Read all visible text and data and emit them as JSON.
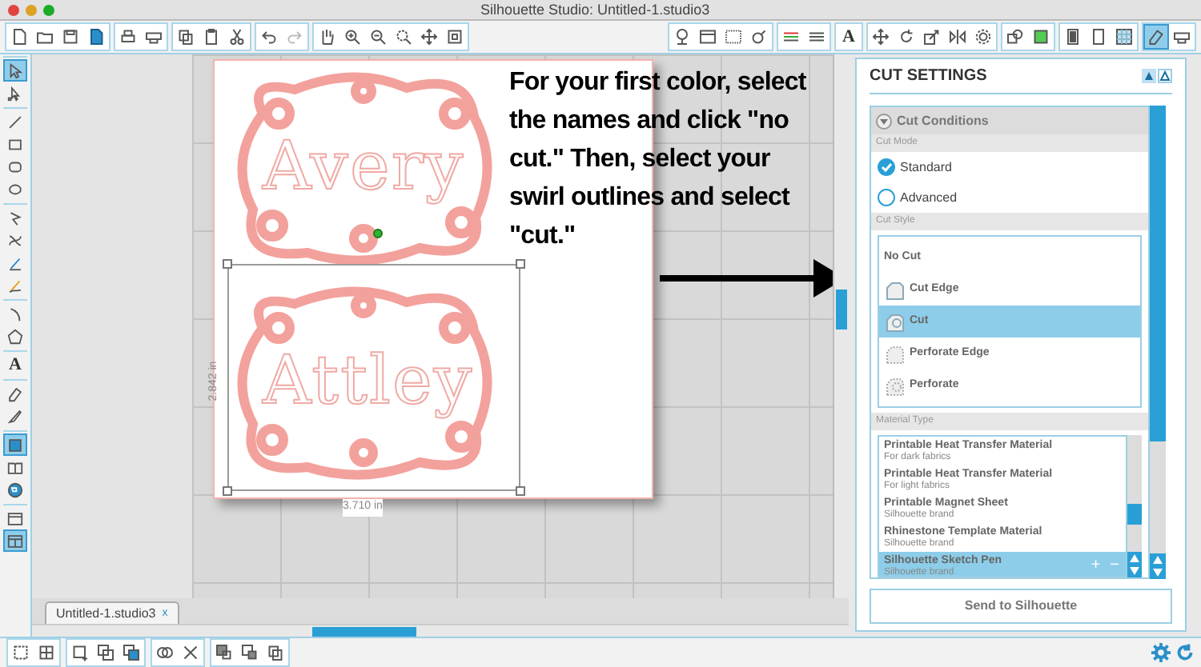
{
  "window": {
    "title": "Silhouette Studio: Untitled-1.studio3"
  },
  "top_toolbar": {
    "left_groups": [
      [
        {
          "kind": "page"
        },
        {
          "kind": "folder"
        },
        {
          "kind": "disk"
        },
        {
          "kind": "filled-page"
        }
      ],
      [
        {
          "kind": "printer"
        },
        {
          "kind": "cutter"
        }
      ],
      [
        {
          "kind": "two-pages"
        },
        {
          "kind": "clipboard"
        },
        {
          "kind": "scissors"
        }
      ],
      [
        {
          "kind": "undo-arrow"
        },
        {
          "kind": "redo-arrow"
        }
      ],
      [
        {
          "kind": "hand"
        },
        {
          "kind": "magnifier-plus"
        },
        {
          "kind": "magnifier-minus"
        },
        {
          "kind": "magnifier-box"
        },
        {
          "kind": "four-arrows"
        },
        {
          "kind": "corner-square"
        }
      ]
    ],
    "right_groups": [
      [
        {
          "kind": "pin-globe",
          "selected": false
        },
        {
          "kind": "window",
          "selected": false
        },
        {
          "kind": "dotted-grid",
          "selected": false
        },
        {
          "kind": "ring",
          "selected": false
        }
      ],
      [
        {
          "kind": "color-lines",
          "selected": false
        },
        {
          "kind": "lines",
          "selected": false
        }
      ],
      [
        {
          "kind": "glyph",
          "glyph": "A",
          "selected": false
        }
      ],
      [
        {
          "kind": "four-arrows",
          "selected": false
        },
        {
          "kind": "rotate",
          "selected": false
        },
        {
          "kind": "scale-box",
          "selected": false
        },
        {
          "kind": "mirror",
          "selected": false
        },
        {
          "kind": "gear",
          "selected": false
        }
      ],
      [
        {
          "kind": "stacked-shapes",
          "selected": false
        },
        {
          "kind": "filled-square",
          "selected": false
        }
      ],
      [
        {
          "kind": "tall-page",
          "selected": false
        },
        {
          "kind": "page-outline",
          "selected": false
        },
        {
          "kind": "grid-page",
          "selected": false
        }
      ],
      [
        {
          "kind": "eraser",
          "selected": true
        },
        {
          "kind": "cutter",
          "selected": false
        }
      ]
    ]
  },
  "left_toolbar": [
    [
      {
        "kind": "arrow-cursor",
        "selected": true
      },
      {
        "kind": "node-cursor",
        "selected": false
      }
    ],
    [
      {
        "kind": "line",
        "selected": false
      },
      {
        "kind": "rectangle",
        "selected": false
      },
      {
        "kind": "rounded-rectangle",
        "selected": false
      },
      {
        "kind": "ellipse",
        "selected": false
      }
    ],
    [
      {
        "kind": "polygon-path",
        "selected": false
      },
      {
        "kind": "curve-path",
        "selected": false
      },
      {
        "kind": "pencil-line",
        "selected": false
      },
      {
        "kind": "pencil-curve",
        "selected": false
      }
    ],
    [
      {
        "kind": "arc",
        "selected": false
      },
      {
        "kind": "pentagon",
        "selected": false
      }
    ],
    [
      {
        "kind": "glyph",
        "glyph": "A",
        "selected": false
      }
    ],
    [
      {
        "kind": "eraser",
        "selected": false
      },
      {
        "kind": "knife",
        "selected": false
      }
    ],
    [
      {
        "kind": "design-page",
        "selected": true
      },
      {
        "kind": "open-book",
        "selected": false
      },
      {
        "kind": "globe",
        "selected": false
      }
    ],
    [
      {
        "kind": "window",
        "selected": false
      },
      {
        "kind": "split-window",
        "selected": true
      }
    ]
  ],
  "canvas": {
    "designs": [
      {
        "name": "Avery"
      },
      {
        "name": "Attley"
      }
    ],
    "selection": {
      "height": "2.842 in",
      "width": "3.710 in"
    },
    "annotation": "For your first color, select the names and click \"no cut.\"  Then, select your swirl outlines and select \"cut.\""
  },
  "document_tab": {
    "label": "Untitled-1.studio3",
    "close": "x"
  },
  "cut_settings": {
    "title": "CUT SETTINGS",
    "section": "Cut Conditions",
    "cut_mode_label": "Cut Mode",
    "cut_modes": [
      {
        "label": "Standard",
        "selected": true
      },
      {
        "label": "Advanced",
        "selected": false
      }
    ],
    "cut_style_label": "Cut Style",
    "cut_styles": [
      {
        "label": "No Cut",
        "kind": "none",
        "selected": false
      },
      {
        "label": "Cut Edge",
        "kind": "edge",
        "selected": false
      },
      {
        "label": "Cut",
        "kind": "cut",
        "selected": true
      },
      {
        "label": "Perforate Edge",
        "kind": "perforate-edge",
        "selected": false
      },
      {
        "label": "Perforate",
        "kind": "perforate",
        "selected": false
      }
    ],
    "material_label": "Material Type",
    "materials": [
      {
        "name": "Printable Heat Transfer Material",
        "detail": "For dark fabrics",
        "selected": false
      },
      {
        "name": "Printable Heat Transfer Material",
        "detail": "For light fabrics",
        "selected": false
      },
      {
        "name": "Printable Magnet Sheet",
        "detail": "Silhouette brand",
        "selected": false
      },
      {
        "name": "Rhinestone Template Material",
        "detail": "Silhouette brand",
        "selected": false
      },
      {
        "name": "Silhouette Sketch Pen",
        "detail": "Silhouette brand",
        "selected": true
      }
    ],
    "add": "+",
    "remove": "−",
    "send_button": "Send to Silhouette"
  },
  "bottom_toolbar": [
    [
      {
        "kind": "dashed-square"
      },
      {
        "kind": "grid-square"
      }
    ],
    [
      {
        "kind": "square-plus"
      },
      {
        "kind": "overlap-squares"
      },
      {
        "kind": "stacked-squares"
      }
    ],
    [
      {
        "kind": "link-circles"
      },
      {
        "kind": "cross"
      }
    ],
    [
      {
        "kind": "front-square"
      },
      {
        "kind": "back-square"
      },
      {
        "kind": "two-pages"
      }
    ]
  ]
}
